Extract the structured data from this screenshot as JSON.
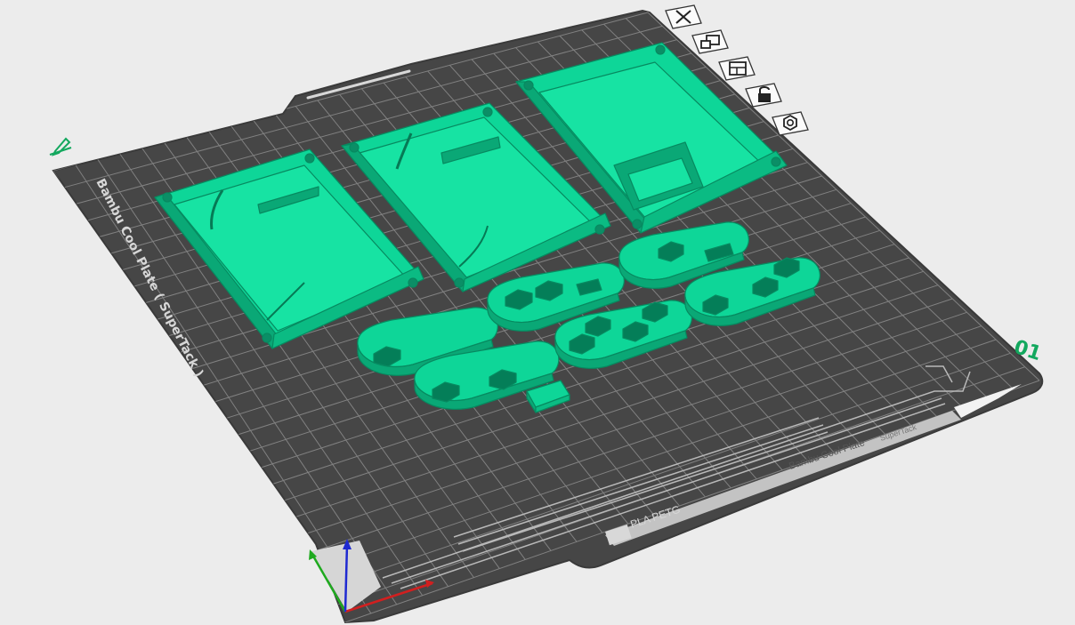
{
  "app": {
    "plate_name": "Bambu Cool Plate ( SuperTack )",
    "plate_bottom_label": "Bambu Cool Plate",
    "plate_bottom_sublabel": "SuperTack",
    "filament_label": "PLA PETG",
    "plate_number": "01"
  },
  "toolbar": {
    "buttons": [
      {
        "name": "delete-plate-button",
        "icon": "close-icon"
      },
      {
        "name": "arrange-button",
        "icon": "arrange-icon"
      },
      {
        "name": "orient-button",
        "icon": "orient-icon"
      },
      {
        "name": "lock-plate-button",
        "icon": "lock-icon"
      },
      {
        "name": "plate-settings-button",
        "icon": "settings-icon"
      }
    ]
  },
  "colors": {
    "accent": "#0ed698",
    "accent_dark": "#079c6e",
    "plate": "#464646",
    "plate_dark": "#393939",
    "grid": "#909090",
    "background": "#ececec",
    "axis_x": "#d11f1f",
    "axis_y": "#1faa1f",
    "axis_z": "#1f2ad1",
    "brand_green": "#13a85e"
  }
}
